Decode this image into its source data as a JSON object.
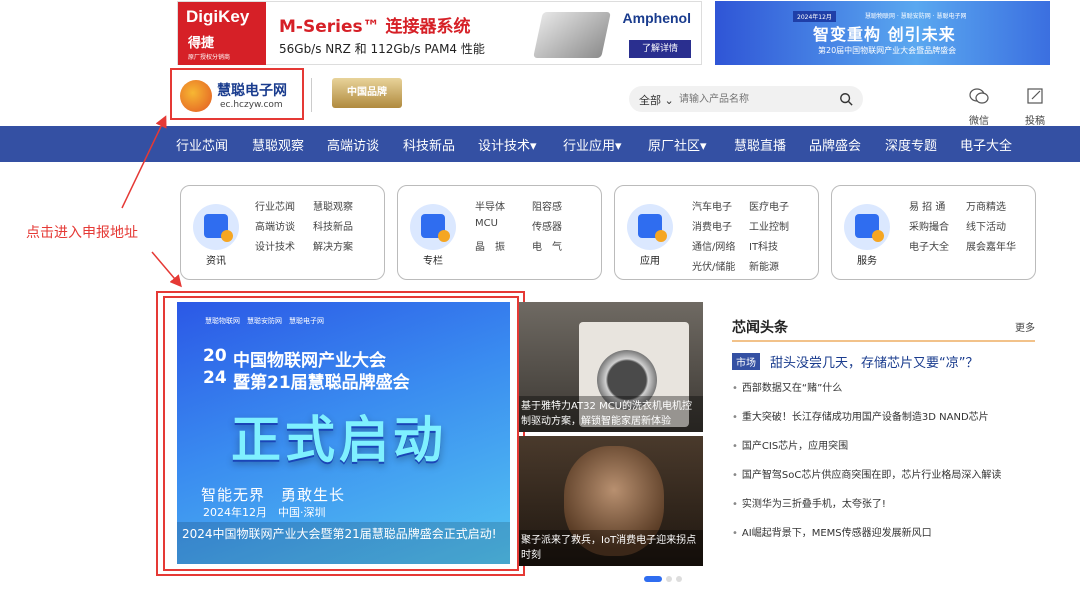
{
  "ads": {
    "digikey": {
      "brand": "DigiKey",
      "brand_cn": "得捷",
      "brand_small": "原厂授权分销商",
      "headline": "M-Series™ 连接器系统",
      "subline": "56Gb/s NRZ 和 112Gb/s PAM4 性能",
      "partner": "Amphenol",
      "cta": "了解详情"
    },
    "expo": {
      "date_badge": "2024年12月",
      "title": "智变重构 创引未来",
      "subtitle": "第20届中国物联网产业大会暨品牌盛会",
      "logos_text": "慧聪物联网 · 慧聪安防网 · 慧聪电子网"
    }
  },
  "header": {
    "logo_cn": "慧聪电子网",
    "logo_url": "ec.hczyw.com",
    "medal_text": "中国品牌",
    "search": {
      "category": "全部",
      "placeholder": "请输入产品名称"
    },
    "icons": [
      {
        "name": "wechat-icon",
        "label": "微信"
      },
      {
        "name": "submit-icon",
        "label": "投稿"
      }
    ]
  },
  "nav": {
    "items": [
      {
        "label": "行业芯闻"
      },
      {
        "label": "慧聪观察"
      },
      {
        "label": "高端访谈"
      },
      {
        "label": "科技新品"
      },
      {
        "label": "设计技术▾"
      },
      {
        "label": "行业应用▾"
      },
      {
        "label": "原厂社区▾"
      },
      {
        "label": "慧聪直播"
      },
      {
        "label": "品牌盛会"
      },
      {
        "label": "深度专题"
      },
      {
        "label": "电子大全"
      }
    ]
  },
  "cards": [
    {
      "name": "资讯",
      "links": [
        "行业芯闻",
        "慧聪观察",
        "高端访谈",
        "科技新品",
        "设计技术",
        "解决方案"
      ]
    },
    {
      "name": "专栏",
      "links": [
        "半导体",
        "阻容感",
        "MCU",
        "传感器",
        "晶　振",
        "电　气"
      ]
    },
    {
      "name": "应用",
      "links": [
        "汽车电子",
        "医疗电子",
        "消费电子",
        "工业控制",
        "通信/网络",
        "IT科技",
        "光伏/储能",
        "新能源"
      ]
    },
    {
      "name": "服务",
      "links": [
        "易 招 通",
        "万商精选",
        "采购撮合",
        "线下活动",
        "电子大全",
        "展会嘉年华"
      ]
    }
  ],
  "annotation": {
    "text": "点击进入申报地址"
  },
  "banner": {
    "logos": "慧聪物联网　慧聪安防网　慧聪电子网",
    "year_top": "20",
    "year_bottom": "24",
    "title_line1": "中国物联网产业大会",
    "title_line2": "暨第21届慧聪品牌盛会",
    "big_text": "正式启动",
    "slogan": "智能无界　勇敢生长",
    "date": "2024年12月　中国·深圳",
    "caption": "2024中国物联网产业大会暨第21届慧聪品牌盛会正式启动!"
  },
  "thumbs": [
    {
      "caption": "基于雅特力AT32 MCU的洗衣机电机控制驱动方案，解锁智能家居新体验"
    },
    {
      "caption": "聚子派来了救兵，IoT消费电子迎来拐点时刻"
    }
  ],
  "news": {
    "title": "芯闻头条",
    "more": "更多",
    "tag": "市场",
    "headline": "甜头没尝几天，存储芯片又要“凉”？",
    "items": [
      "西部数据又在“赌”什么",
      "重大突破！长江存储成功用国产设备制造3D NAND芯片",
      "国产CIS芯片，应用突围",
      "国产智驾SoC芯片供应商突围在即，芯片行业格局深入解读",
      "实测华为三折叠手机，太夸张了!",
      "AI崛起背景下，MEMS传感器迎发展新风口"
    ]
  },
  "colors": {
    "nav_bg": "#3450a3",
    "annotation_red": "#e53935",
    "accent_blue": "#2f6df0"
  }
}
